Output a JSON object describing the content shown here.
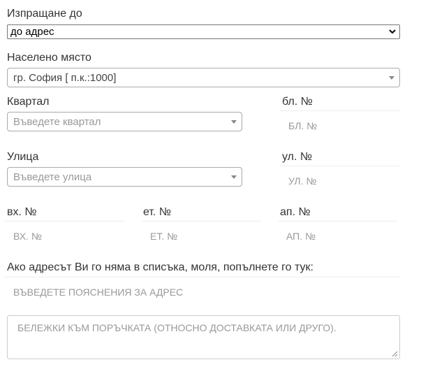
{
  "shipping": {
    "label": "Изпращане до",
    "selected": "до адрес",
    "icon": "chevron-down-icon"
  },
  "city": {
    "label": "Населено място",
    "selected": "гр. София [ п.к.:1000]"
  },
  "district": {
    "label": "Квартал",
    "placeholder": "Въведете квартал"
  },
  "block": {
    "label": "бл. №",
    "placeholder": "БЛ. №"
  },
  "street": {
    "label": "Улица",
    "placeholder": "Въведете улица"
  },
  "street_no": {
    "label": "ул. №",
    "placeholder": "УЛ. №"
  },
  "entrance": {
    "label": "вх. №",
    "placeholder": "ВХ. №"
  },
  "floor": {
    "label": "ет. №",
    "placeholder": "ЕТ. №"
  },
  "apartment": {
    "label": "ап. №",
    "placeholder": "АП. №"
  },
  "address_note": {
    "label": "Ако адресът Ви го няма в списъка, моля, попълнете го тук:",
    "placeholder": "ВЪВЕДЕТЕ ПОЯСНЕНИЯ ЗА АДРЕС"
  },
  "order_notes": {
    "placeholder": "БЕЛЕЖКИ КЪМ ПОРЪЧКАТА (ОТНОСНО ДОСТАВКАТА ИЛИ ДРУГО)."
  },
  "colors": {
    "text": "#333333",
    "placeholder": "#999999",
    "border": "#aaaaaa"
  }
}
